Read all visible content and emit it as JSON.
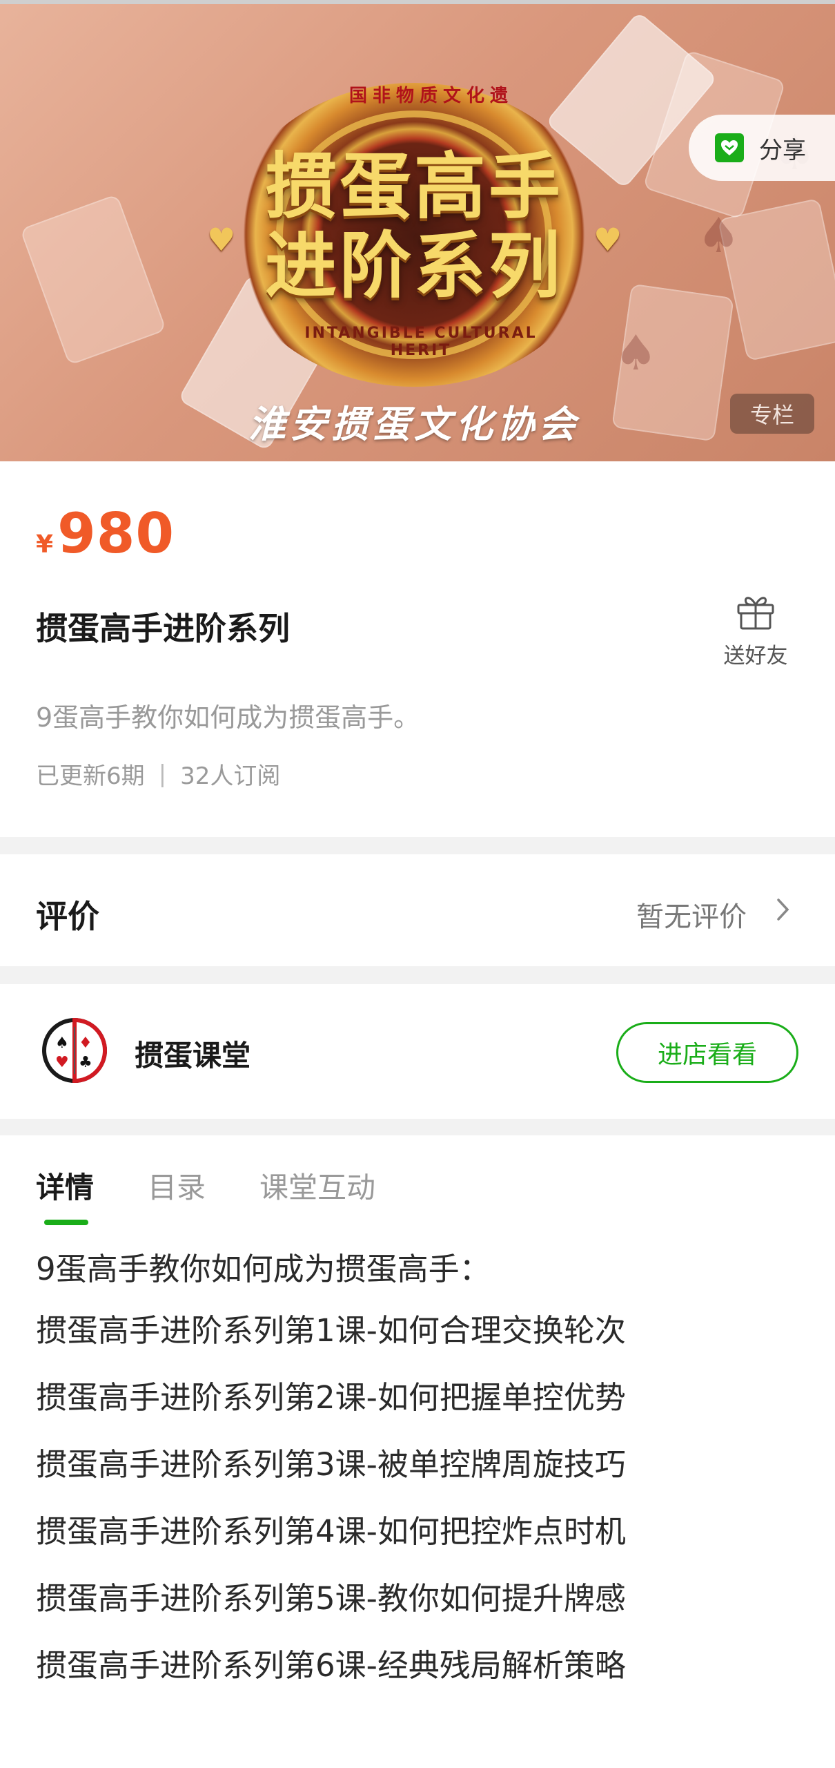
{
  "banner": {
    "title_line1": "掼蛋高手",
    "title_line2": "进阶系列",
    "emblem_top": "国非物质文化遗",
    "emblem_bottom": "INTANGIBLE CULTURAL HERIT",
    "signature": "淮安掼蛋文化协会",
    "share_label": "分享",
    "column_badge": "专栏",
    "share_icon": "wechat-share-icon"
  },
  "product": {
    "currency": "¥",
    "price": "980",
    "title": "掼蛋高手进阶系列",
    "gift_label": "送好友",
    "gift_icon": "gift-icon",
    "description": "9蛋高手教你如何成为掼蛋高手。",
    "updated": "已更新6期",
    "separator": "|",
    "subscribers": "32人订阅"
  },
  "review": {
    "label": "评价",
    "value": "暂无评价",
    "chevron_icon": "chevron-right-icon"
  },
  "shop": {
    "name": "掼蛋课堂",
    "enter_label": "进店看看",
    "avatar_icon": "playing-cards-logo-icon"
  },
  "tabs": [
    {
      "label": "详情",
      "active": true
    },
    {
      "label": "目录",
      "active": false
    },
    {
      "label": "课堂互动",
      "active": false
    }
  ],
  "detail": {
    "lines": [
      "9蛋高手教你如何成为掼蛋高手：",
      "掼蛋高手进阶系列第1课-如何合理交换轮次",
      "掼蛋高手进阶系列第2课-如何把握单控优势",
      "掼蛋高手进阶系列第3课-被单控牌周旋技巧",
      "掼蛋高手进阶系列第4课-如何把控炸点时机",
      "掼蛋高手进阶系列第5课-教你如何提升牌感",
      "掼蛋高手进阶系列第6课-经典残局解析策略"
    ]
  },
  "colors": {
    "accent_green": "#1aad19",
    "price_orange": "#f05a28",
    "banner_bg": "#d9977c",
    "gold": "#f7d96a"
  }
}
